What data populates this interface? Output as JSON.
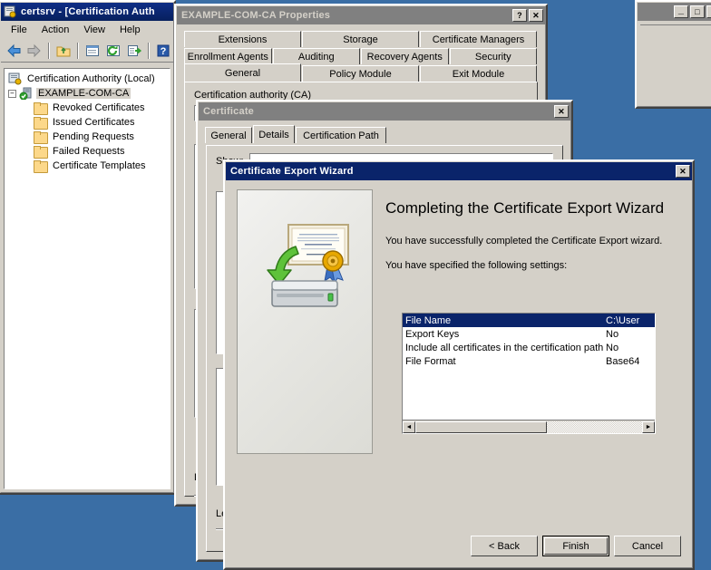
{
  "desktop": {
    "background_color": "#3a6ea5"
  },
  "mmc_window": {
    "title": "certsrv - [Certification Authority (Local)\\EXAMPLE-COM-CA]",
    "title_short": "certsrv - [Certification Auth",
    "icon": "certsrv-icon",
    "menus": [
      "File",
      "Action",
      "View",
      "Help"
    ],
    "toolbar": [
      {
        "name": "back-icon",
        "label": "Back"
      },
      {
        "name": "forward-icon",
        "label": "Forward"
      },
      {
        "name": "up-one-level-icon",
        "label": "Up One Level"
      },
      {
        "name": "properties-icon",
        "label": "Properties"
      },
      {
        "name": "refresh-icon",
        "label": "Refresh"
      },
      {
        "name": "export-list-icon",
        "label": "Export List"
      },
      {
        "name": "help-icon",
        "label": "Help"
      }
    ],
    "tree": {
      "root": "Certification Authority (Local)",
      "ca_node": "EXAMPLE-COM-CA",
      "children": [
        "Revoked Certificates",
        "Issued Certificates",
        "Pending Requests",
        "Failed Requests",
        "Certificate Templates"
      ]
    }
  },
  "background_window": {
    "minimize_label": "_",
    "maximize_label": "□",
    "close_label": "✕"
  },
  "properties_dialog": {
    "title": "EXAMPLE-COM-CA Properties",
    "help_label": "?",
    "close_label": "✕",
    "tab_rows": [
      [
        "Extensions",
        "Storage",
        "Certificate Managers"
      ],
      [
        "Enrollment Agents",
        "Auditing",
        "Recovery Agents",
        "Security"
      ],
      [
        "General",
        "Policy Module",
        "Exit Module"
      ]
    ],
    "active_tab": "General",
    "ca_label": "Certification authority (CA)",
    "learn_label": "Learn more about"
  },
  "certificate_dialog": {
    "title": "Certificate",
    "close_label": "✕",
    "tabs": [
      "General",
      "Details",
      "Certification Path"
    ],
    "active_tab": "Details",
    "show_label": "Show:",
    "learn_label": "Learn more about"
  },
  "wizard": {
    "title": "Certificate Export Wizard",
    "close_label": "✕",
    "heading": "Completing the Certificate Export Wizard",
    "paragraph1": "You have successfully completed the Certificate Export wizard.",
    "paragraph2": "You have specified the following settings:",
    "banner_icon": "certificate-export-banner-icon",
    "settings": [
      {
        "key": "File Name",
        "value": "C:\\User",
        "selected": true
      },
      {
        "key": "Export Keys",
        "value": "No",
        "selected": false
      },
      {
        "key": "Include all certificates in the certification path",
        "value": "No",
        "selected": false
      },
      {
        "key": "File Format",
        "value": "Base64",
        "selected": false
      }
    ],
    "scroll_left_label": "◄",
    "scroll_right_label": "►",
    "buttons": {
      "back": "< Back",
      "finish": "Finish",
      "cancel": "Cancel"
    }
  }
}
